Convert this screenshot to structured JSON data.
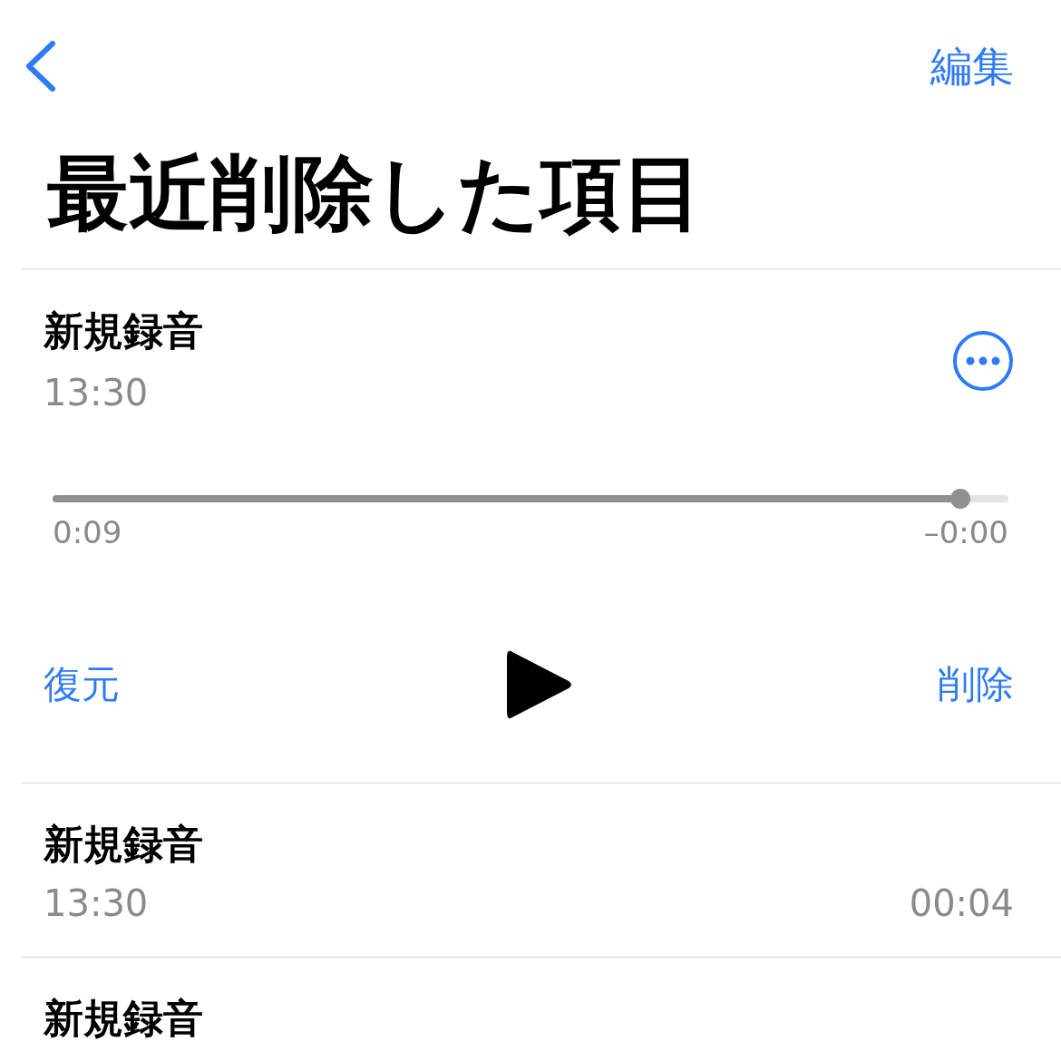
{
  "nav": {
    "edit": "編集"
  },
  "title": "最近削除した項目",
  "recordings": [
    {
      "kind": "expanded",
      "title": "新規録音",
      "time": "13:30",
      "player": {
        "level": 0.95,
        "elapsed": "0:09",
        "remaining": "–0:00",
        "restore": "復元",
        "delete": "削除"
      }
    },
    {
      "kind": "collapsed",
      "title": "新規録音",
      "time": "13:30",
      "duration": "00:04"
    },
    {
      "kind": "collapsed",
      "title": "新規録音"
    }
  ]
}
